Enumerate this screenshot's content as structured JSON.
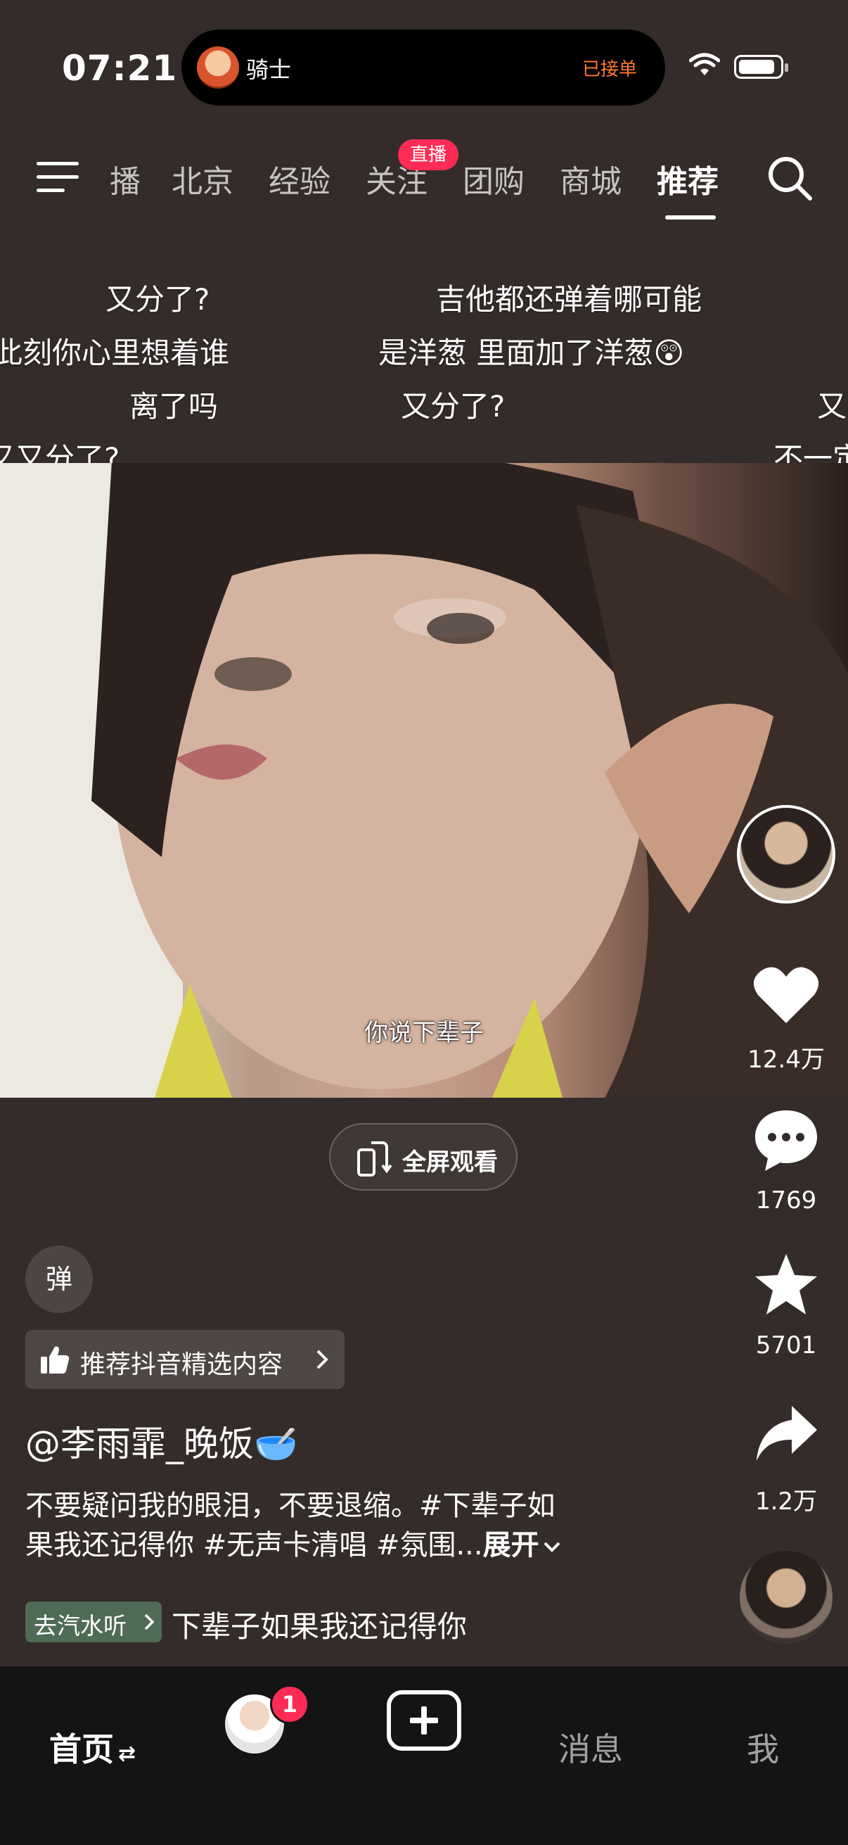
{
  "status_bar": {
    "time": "07:21"
  },
  "dynamic_island": {
    "name": "骑士",
    "status": "已接单"
  },
  "top_nav": {
    "tabs": [
      "播",
      "北京",
      "经验",
      "关注",
      "团购",
      "商城",
      "推荐"
    ],
    "active_tab": "推荐",
    "live_badge": "直播"
  },
  "danmaku": [
    "又分了?",
    "吉他都还弹着哪可能",
    "此刻你心里想着谁",
    "是洋葱 里面加了洋葱😲",
    "离了吗",
    "又分了?",
    "又",
    "又又分了?",
    "不一定"
  ],
  "video": {
    "subtitle": "你说下辈子"
  },
  "actions": {
    "likes": "12.4万",
    "comments": "1769",
    "favorites": "5701",
    "shares": "1.2万"
  },
  "fullscreen_label": "全屏观看",
  "danmaku_toggle": "弹",
  "recommend_chip": "推荐抖音精选内容",
  "author": "@李雨霏_晚饭🥣",
  "description": {
    "line1": "不要疑问我的眼泪，不要退缩。#下辈子如",
    "line2": "果我还记得你 #无声卡清唱 #氛围...",
    "expand": "展开"
  },
  "music": {
    "chip": "去汽水听",
    "title": "下辈子如果我还记得你"
  },
  "bottom_nav": {
    "home": "首页",
    "friend_badge": "1",
    "messages": "消息",
    "me": "我"
  },
  "colors": {
    "background": "#342c2a",
    "accent": "#fe2c55",
    "island_status": "#ff7a2d",
    "bottom_bar": "#141414"
  }
}
